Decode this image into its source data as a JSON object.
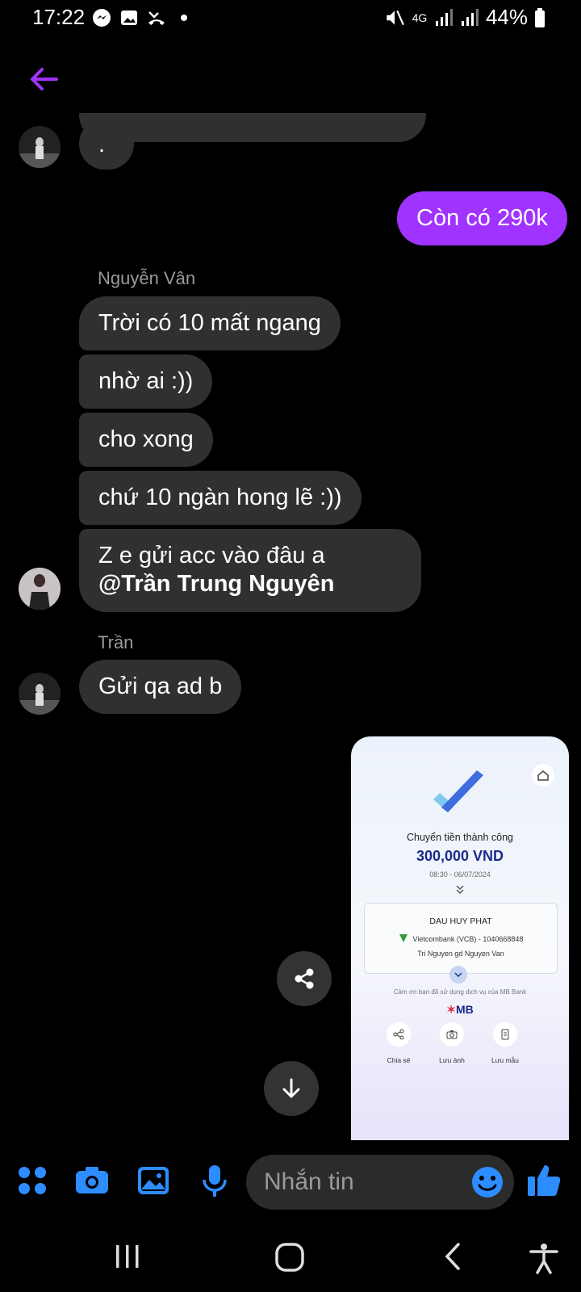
{
  "status": {
    "time": "17:22",
    "network": "4G",
    "battery": "44%"
  },
  "messages": [
    {
      "text": "."
    },
    {
      "text": "Còn có 290k",
      "mine": true
    },
    {
      "sender": "Nguyễn Vân"
    },
    {
      "text": "Trời có 10 mất ngang"
    },
    {
      "text": "nhờ ai :))"
    },
    {
      "text": "cho xong"
    },
    {
      "text": "chứ 10 ngàn hong lẽ :))"
    },
    {
      "text_prefix": "Z e gửi acc vào đâu a ",
      "mention": "@Trần Trung Nguyên"
    },
    {
      "sender": "Trần"
    },
    {
      "text": "Gửi qa ad b"
    }
  ],
  "transfer": {
    "title": "Chuyển tiền thành công",
    "amount": "300,000 VND",
    "datetime": "08:30 - 06/07/2024",
    "recipient": "DAU HUY PHAT",
    "bank": "Vietcombank (VCB) - 1040668848",
    "note": "Tri Nguyen gd Nguyen Van",
    "thanks": "Cảm ơn bạn đã sử dụng dịch vụ của MB Bank",
    "brand": "MB",
    "actions": [
      "Chia sẻ",
      "Lưu ảnh",
      "Lưu mẫu"
    ]
  },
  "composer": {
    "placeholder": "Nhắn tin"
  },
  "colors": {
    "accent": "#a033ff",
    "bubble": "#303030",
    "icon_blue": "#2d8cff"
  }
}
